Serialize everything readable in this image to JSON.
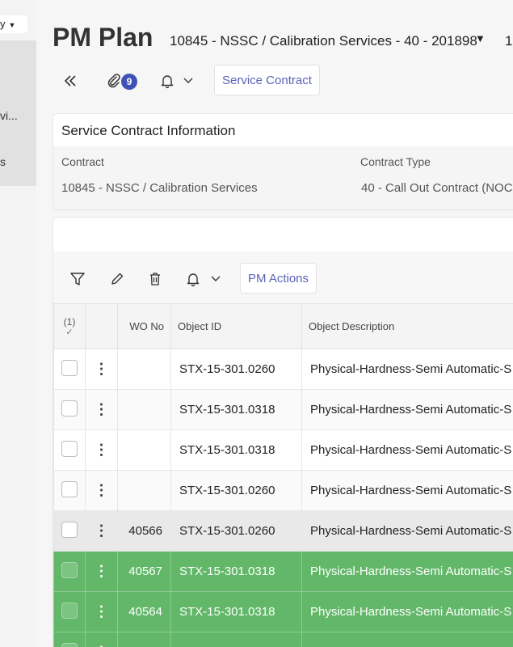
{
  "nav": {
    "dropdown_label": "y",
    "items": [
      "vi...",
      "s"
    ]
  },
  "header": {
    "title": "PM Plan",
    "subtitle": "10845 - NSSC / Calibration Services - 40 - 201898",
    "extra": "1"
  },
  "toolbar": {
    "attachments_count": "9",
    "service_contract_label": "Service Contract"
  },
  "contract_card": {
    "heading": "Service Contract Information",
    "fields": [
      {
        "label": "Contract",
        "value": "10845 - NSSC / Calibration Services"
      },
      {
        "label": "Contract Type",
        "value": "40 - Call Out Contract (NOC"
      }
    ]
  },
  "grid": {
    "pm_actions_label": "PM Actions",
    "header": {
      "select_count": "(1)",
      "select_check": "✓",
      "wo_no": "WO No",
      "object_id": "Object ID",
      "object_description": "Object Description"
    },
    "rows": [
      {
        "wo_no": "",
        "object_id": "STX-15-301.0260",
        "description": "Physical-Hardness-Semi Automatic-S",
        "state": "normal"
      },
      {
        "wo_no": "",
        "object_id": "STX-15-301.0318",
        "description": "Physical-Hardness-Semi Automatic-S",
        "state": "zebra"
      },
      {
        "wo_no": "",
        "object_id": "STX-15-301.0318",
        "description": "Physical-Hardness-Semi Automatic-S",
        "state": "normal"
      },
      {
        "wo_no": "",
        "object_id": "STX-15-301.0260",
        "description": "Physical-Hardness-Semi Automatic-S",
        "state": "zebra"
      },
      {
        "wo_no": "40566",
        "object_id": "STX-15-301.0260",
        "description": "Physical-Hardness-Semi Automatic-S",
        "state": "sel"
      },
      {
        "wo_no": "40567",
        "object_id": "STX-15-301.0318",
        "description": "Physical-Hardness-Semi Automatic-S",
        "state": "green"
      },
      {
        "wo_no": "40564",
        "object_id": "STX-15-301.0318",
        "description": "Physical-Hardness-Semi Automatic-S",
        "state": "green"
      },
      {
        "wo_no": "",
        "object_id": "",
        "description": "",
        "state": "green"
      }
    ]
  },
  "colors": {
    "accent": "#3f51b5",
    "link_text": "#5b63b7",
    "highlight_green": "#62b768"
  }
}
